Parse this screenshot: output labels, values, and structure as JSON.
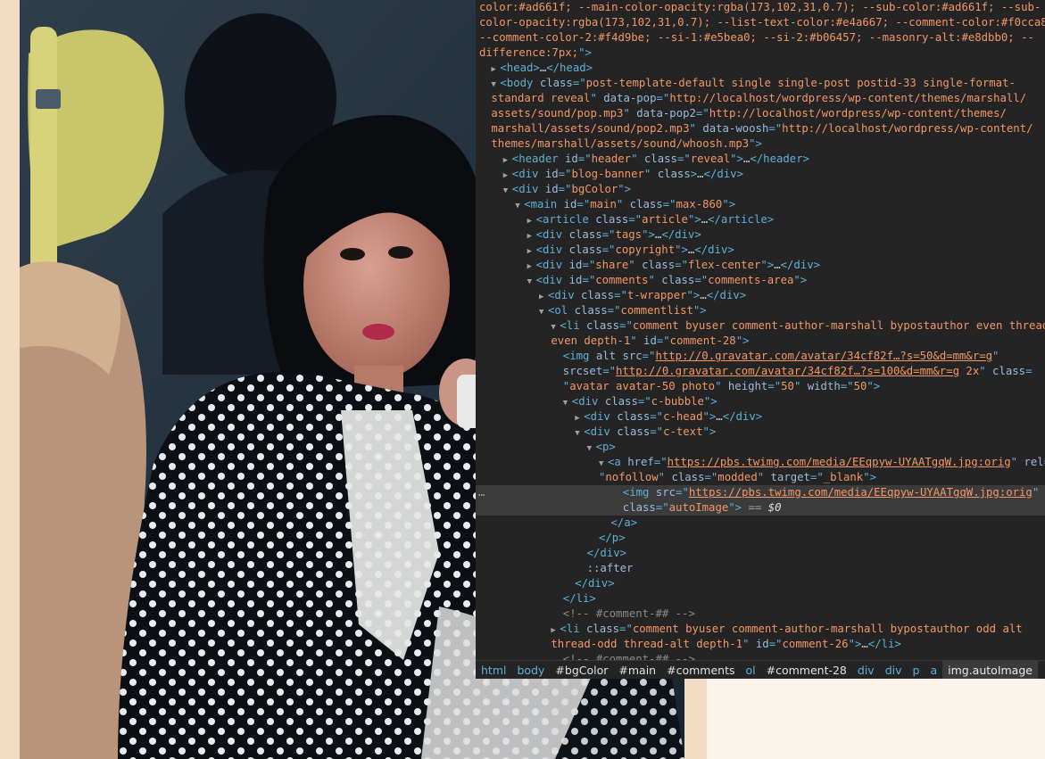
{
  "devtools": {
    "lines": [
      {
        "i": 0,
        "seg": [
          [
            "av",
            "color:#ad661f; --main-color-opacity:rgba(173,102,31,0.7); --sub-color:#ad661f; --sub-"
          ]
        ]
      },
      {
        "i": 0,
        "seg": [
          [
            "av",
            "color-opacity:rgba(173,102,31,0.7); --list-text-color:#e4a667; --comment-color:#f0cca8;"
          ]
        ]
      },
      {
        "i": 0,
        "seg": [
          [
            "av",
            "--comment-color-2:#f4d9be; --si-1:#e5bea0; --si-2:#b06457; --masonry-alt:#e8dbb0; --"
          ]
        ]
      },
      {
        "i": 0,
        "seg": [
          [
            "av",
            "difference:7px;"
          ],
          [
            "tg",
            "\">"
          ]
        ]
      },
      {
        "i": 1,
        "a": "c",
        "seg": [
          [
            "tg",
            "<head>"
          ],
          [
            "tx",
            "…"
          ],
          [
            "tg",
            "</head>"
          ]
        ]
      },
      {
        "i": 1,
        "a": "o",
        "seg": [
          [
            "tg",
            "<body "
          ],
          [
            "at",
            "class"
          ],
          [
            "tg",
            "=\""
          ],
          [
            "av",
            "post-template-default single single-post postid-33 single-format-"
          ]
        ]
      },
      {
        "i": 1,
        "seg": [
          [
            "av",
            "standard reveal"
          ],
          [
            "tg",
            "\" "
          ],
          [
            "at",
            "data-pop"
          ],
          [
            "tg",
            "=\""
          ],
          [
            "av",
            "http://localhost/wordpress/wp-content/themes/marshall/"
          ]
        ]
      },
      {
        "i": 1,
        "seg": [
          [
            "av",
            "assets/sound/pop.mp3"
          ],
          [
            "tg",
            "\" "
          ],
          [
            "at",
            "data-pop2"
          ],
          [
            "tg",
            "=\""
          ],
          [
            "av",
            "http://localhost/wordpress/wp-content/themes/"
          ]
        ]
      },
      {
        "i": 1,
        "seg": [
          [
            "av",
            "marshall/assets/sound/pop2.mp3"
          ],
          [
            "tg",
            "\" "
          ],
          [
            "at",
            "data-woosh"
          ],
          [
            "tg",
            "=\""
          ],
          [
            "av",
            "http://localhost/wordpress/wp-content/"
          ]
        ]
      },
      {
        "i": 1,
        "seg": [
          [
            "av",
            "themes/marshall/assets/sound/whoosh.mp3"
          ],
          [
            "tg",
            "\">"
          ]
        ]
      },
      {
        "i": 2,
        "a": "c",
        "seg": [
          [
            "tg",
            "<header "
          ],
          [
            "at",
            "id"
          ],
          [
            "tg",
            "=\""
          ],
          [
            "av",
            "header"
          ],
          [
            "tg",
            "\" "
          ],
          [
            "at",
            "class"
          ],
          [
            "tg",
            "=\""
          ],
          [
            "av",
            "reveal"
          ],
          [
            "tg",
            "\">"
          ],
          [
            "tx",
            "…"
          ],
          [
            "tg",
            "</header>"
          ]
        ]
      },
      {
        "i": 2,
        "a": "c",
        "seg": [
          [
            "tg",
            "<div "
          ],
          [
            "at",
            "id"
          ],
          [
            "tg",
            "=\""
          ],
          [
            "av",
            "blog-banner"
          ],
          [
            "tg",
            "\" "
          ],
          [
            "at",
            "class"
          ],
          [
            "tg",
            ">"
          ],
          [
            "tx",
            "…"
          ],
          [
            "tg",
            "</div>"
          ]
        ]
      },
      {
        "i": 2,
        "a": "o",
        "seg": [
          [
            "tg",
            "<div "
          ],
          [
            "at",
            "id"
          ],
          [
            "tg",
            "=\""
          ],
          [
            "av",
            "bgColor"
          ],
          [
            "tg",
            "\">"
          ]
        ]
      },
      {
        "i": 3,
        "a": "o",
        "seg": [
          [
            "tg",
            "<main "
          ],
          [
            "at",
            "id"
          ],
          [
            "tg",
            "=\""
          ],
          [
            "av",
            "main"
          ],
          [
            "tg",
            "\" "
          ],
          [
            "at",
            "class"
          ],
          [
            "tg",
            "=\""
          ],
          [
            "av",
            "max-860"
          ],
          [
            "tg",
            "\">"
          ]
        ]
      },
      {
        "i": 4,
        "a": "c",
        "seg": [
          [
            "tg",
            "<article "
          ],
          [
            "at",
            "class"
          ],
          [
            "tg",
            "=\""
          ],
          [
            "av",
            "article"
          ],
          [
            "tg",
            "\">"
          ],
          [
            "tx",
            "…"
          ],
          [
            "tg",
            "</article>"
          ]
        ]
      },
      {
        "i": 4,
        "a": "c",
        "seg": [
          [
            "tg",
            "<div "
          ],
          [
            "at",
            "class"
          ],
          [
            "tg",
            "=\""
          ],
          [
            "av",
            "tags"
          ],
          [
            "tg",
            "\">"
          ],
          [
            "tx",
            "…"
          ],
          [
            "tg",
            "</div>"
          ]
        ]
      },
      {
        "i": 4,
        "a": "c",
        "seg": [
          [
            "tg",
            "<div "
          ],
          [
            "at",
            "class"
          ],
          [
            "tg",
            "=\""
          ],
          [
            "av",
            "copyright"
          ],
          [
            "tg",
            "\">"
          ],
          [
            "tx",
            "…"
          ],
          [
            "tg",
            "</div>"
          ]
        ]
      },
      {
        "i": 4,
        "a": "c",
        "seg": [
          [
            "tg",
            "<div "
          ],
          [
            "at",
            "id"
          ],
          [
            "tg",
            "=\""
          ],
          [
            "av",
            "share"
          ],
          [
            "tg",
            "\" "
          ],
          [
            "at",
            "class"
          ],
          [
            "tg",
            "=\""
          ],
          [
            "av",
            "flex-center"
          ],
          [
            "tg",
            "\">"
          ],
          [
            "tx",
            "…"
          ],
          [
            "tg",
            "</div>"
          ]
        ]
      },
      {
        "i": 4,
        "a": "o",
        "seg": [
          [
            "tg",
            "<div "
          ],
          [
            "at",
            "id"
          ],
          [
            "tg",
            "=\""
          ],
          [
            "av",
            "comments"
          ],
          [
            "tg",
            "\" "
          ],
          [
            "at",
            "class"
          ],
          [
            "tg",
            "=\""
          ],
          [
            "av",
            "comments-area"
          ],
          [
            "tg",
            "\">"
          ]
        ]
      },
      {
        "i": 5,
        "a": "c",
        "seg": [
          [
            "tg",
            "<div "
          ],
          [
            "at",
            "class"
          ],
          [
            "tg",
            "=\""
          ],
          [
            "av",
            "t-wrapper"
          ],
          [
            "tg",
            "\">"
          ],
          [
            "tx",
            "…"
          ],
          [
            "tg",
            "</div>"
          ]
        ]
      },
      {
        "i": 5,
        "a": "o",
        "seg": [
          [
            "tg",
            "<ol "
          ],
          [
            "at",
            "class"
          ],
          [
            "tg",
            "=\""
          ],
          [
            "av",
            "commentlist"
          ],
          [
            "tg",
            "\">"
          ]
        ]
      },
      {
        "i": 6,
        "a": "o",
        "seg": [
          [
            "tg",
            "<li "
          ],
          [
            "at",
            "class"
          ],
          [
            "tg",
            "=\""
          ],
          [
            "av",
            "comment byuser comment-author-marshall bypostauthor even thread-"
          ]
        ]
      },
      {
        "i": 6,
        "seg": [
          [
            "av",
            "even depth-1"
          ],
          [
            "tg",
            "\" "
          ],
          [
            "at",
            "id"
          ],
          [
            "tg",
            "=\""
          ],
          [
            "av",
            "comment-28"
          ],
          [
            "tg",
            "\">"
          ]
        ]
      },
      {
        "i": 7,
        "seg": [
          [
            "tg",
            "<img "
          ],
          [
            "at",
            "alt src"
          ],
          [
            "tg",
            "=\""
          ],
          [
            "lk",
            "http://0.gravatar.com/avatar/34cf82f…?s=50&d=mm&r=g"
          ],
          [
            "tg",
            "\""
          ]
        ]
      },
      {
        "i": 7,
        "seg": [
          [
            "at",
            "srcset"
          ],
          [
            "tg",
            "=\""
          ],
          [
            "lk",
            "http://0.gravatar.com/avatar/34cf82f…?s=100&d=mm&r=g"
          ],
          [
            "av",
            " 2x"
          ],
          [
            "tg",
            "\" "
          ],
          [
            "at",
            "class"
          ],
          [
            "tg",
            "="
          ]
        ]
      },
      {
        "i": 7,
        "seg": [
          [
            "tg",
            "\""
          ],
          [
            "av",
            "avatar avatar-50 photo"
          ],
          [
            "tg",
            "\" "
          ],
          [
            "at",
            "height"
          ],
          [
            "tg",
            "=\""
          ],
          [
            "av",
            "50"
          ],
          [
            "tg",
            "\" "
          ],
          [
            "at",
            "width"
          ],
          [
            "tg",
            "=\""
          ],
          [
            "av",
            "50"
          ],
          [
            "tg",
            "\">"
          ]
        ]
      },
      {
        "i": 7,
        "a": "o",
        "seg": [
          [
            "tg",
            "<div "
          ],
          [
            "at",
            "class"
          ],
          [
            "tg",
            "=\""
          ],
          [
            "av",
            "c-bubble"
          ],
          [
            "tg",
            "\">"
          ]
        ]
      },
      {
        "i": 8,
        "a": "c",
        "seg": [
          [
            "tg",
            "<div "
          ],
          [
            "at",
            "class"
          ],
          [
            "tg",
            "=\""
          ],
          [
            "av",
            "c-head"
          ],
          [
            "tg",
            "\">"
          ],
          [
            "tx",
            "…"
          ],
          [
            "tg",
            "</div>"
          ]
        ]
      },
      {
        "i": 8,
        "a": "o",
        "seg": [
          [
            "tg",
            "<div "
          ],
          [
            "at",
            "class"
          ],
          [
            "tg",
            "=\""
          ],
          [
            "av",
            "c-text"
          ],
          [
            "tg",
            "\">"
          ]
        ]
      },
      {
        "i": 9,
        "a": "o",
        "seg": [
          [
            "tg",
            "<p>"
          ]
        ]
      },
      {
        "i": 10,
        "a": "o",
        "seg": [
          [
            "tg",
            "<a "
          ],
          [
            "at",
            "href"
          ],
          [
            "tg",
            "=\""
          ],
          [
            "lk",
            "https://pbs.twimg.com/media/EEqpyw-UYAATgqW.jpg:orig"
          ],
          [
            "tg",
            "\" "
          ],
          [
            "at",
            "rel"
          ],
          [
            "tg",
            "="
          ]
        ]
      },
      {
        "i": 10,
        "seg": [
          [
            "tg",
            "\""
          ],
          [
            "av",
            "nofollow"
          ],
          [
            "tg",
            "\" "
          ],
          [
            "at",
            "class"
          ],
          [
            "tg",
            "=\""
          ],
          [
            "av",
            "modded"
          ],
          [
            "tg",
            "\" "
          ],
          [
            "at",
            "target"
          ],
          [
            "tg",
            "=\""
          ],
          [
            "av",
            "_blank"
          ],
          [
            "tg",
            "\">"
          ]
        ]
      },
      {
        "i": 12,
        "sel": true,
        "seg": [
          [
            "tg",
            "<img "
          ],
          [
            "at",
            "src"
          ],
          [
            "tg",
            "=\""
          ],
          [
            "lk",
            "https://pbs.twimg.com/media/EEqpyw-UYAATgqW.jpg:orig"
          ],
          [
            "tg",
            "\""
          ]
        ]
      },
      {
        "i": 12,
        "sel": true,
        "seg": [
          [
            "at",
            "class"
          ],
          [
            "tg",
            "=\""
          ],
          [
            "av",
            "autoImage"
          ],
          [
            "tg",
            "\">"
          ],
          [
            "eq",
            " == "
          ],
          [
            "dl",
            "$0"
          ]
        ]
      },
      {
        "i": 11,
        "seg": [
          [
            "tg",
            "</a>"
          ]
        ]
      },
      {
        "i": 10,
        "seg": [
          [
            "tg",
            "</p>"
          ]
        ]
      },
      {
        "i": 9,
        "seg": [
          [
            "tg",
            "</div>"
          ]
        ]
      },
      {
        "i": 9,
        "seg": [
          [
            "ps",
            "::after"
          ]
        ]
      },
      {
        "i": 8,
        "seg": [
          [
            "tg",
            "</div>"
          ]
        ]
      },
      {
        "i": 7,
        "seg": [
          [
            "tg",
            "</li>"
          ]
        ]
      },
      {
        "i": 7,
        "seg": [
          [
            "cm",
            "<!-- #comment-## -->"
          ]
        ]
      },
      {
        "i": 6,
        "a": "c",
        "seg": [
          [
            "tg",
            "<li "
          ],
          [
            "at",
            "class"
          ],
          [
            "tg",
            "=\""
          ],
          [
            "av",
            "comment byuser comment-author-marshall bypostauthor odd alt"
          ]
        ]
      },
      {
        "i": 6,
        "seg": [
          [
            "av",
            "thread-odd thread-alt depth-1"
          ],
          [
            "tg",
            "\" "
          ],
          [
            "at",
            "id"
          ],
          [
            "tg",
            "=\""
          ],
          [
            "av",
            "comment-26"
          ],
          [
            "tg",
            "\">"
          ],
          [
            "tx",
            "…"
          ],
          [
            "tg",
            "</li>"
          ]
        ]
      },
      {
        "i": 7,
        "seg": [
          [
            "cm",
            "<!-- #comment-## -->"
          ]
        ]
      }
    ],
    "selected_marker": "…",
    "breadcrumbs": [
      {
        "label": "html",
        "kind": "tag"
      },
      {
        "label": "body",
        "kind": "tag"
      },
      {
        "label": "#bgColor",
        "kind": "id"
      },
      {
        "label": "#main",
        "kind": "id"
      },
      {
        "label": "#comments",
        "kind": "id"
      },
      {
        "label": "ol",
        "kind": "tag"
      },
      {
        "label": "#comment-28",
        "kind": "id"
      },
      {
        "label": "div",
        "kind": "tag"
      },
      {
        "label": "div",
        "kind": "tag"
      },
      {
        "label": "p",
        "kind": "tag"
      },
      {
        "label": "a",
        "kind": "tag"
      },
      {
        "label": "img.autoImage",
        "kind": "current"
      }
    ]
  }
}
